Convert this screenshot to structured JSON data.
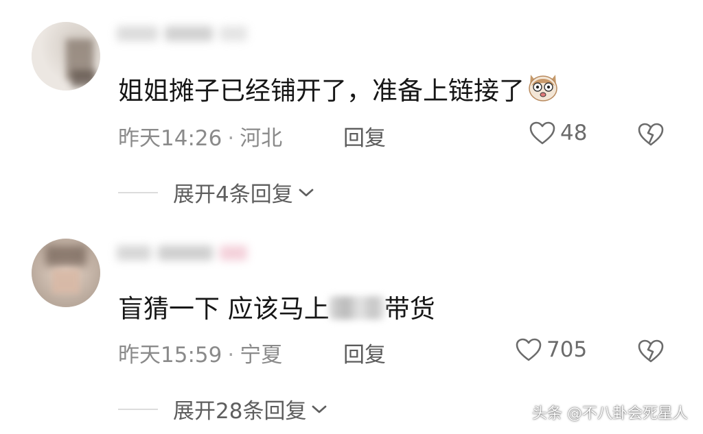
{
  "comments": [
    {
      "text": "姐姐摊子已经铺开了，准备上链接了",
      "emoji": "shocked-dog-emoji",
      "time": "昨天14:26",
      "location": "河北",
      "reply_label": "回复",
      "likes": "48",
      "expand_label": "展开4条回复"
    },
    {
      "text_before": "盲猜一下 应该马上",
      "text_after": "带货",
      "time": "昨天15:59",
      "location": "宁夏",
      "reply_label": "回复",
      "likes": "705",
      "expand_label": "展开28条回复"
    }
  ],
  "meta_separator": "·",
  "watermark": "头条 @不八卦会死星人",
  "colors": {
    "text_primary": "#161616",
    "text_secondary": "#8a8a8a",
    "background": "#ffffff"
  },
  "icons": [
    "heart-outline-icon",
    "broken-heart-icon",
    "chevron-down-icon"
  ]
}
